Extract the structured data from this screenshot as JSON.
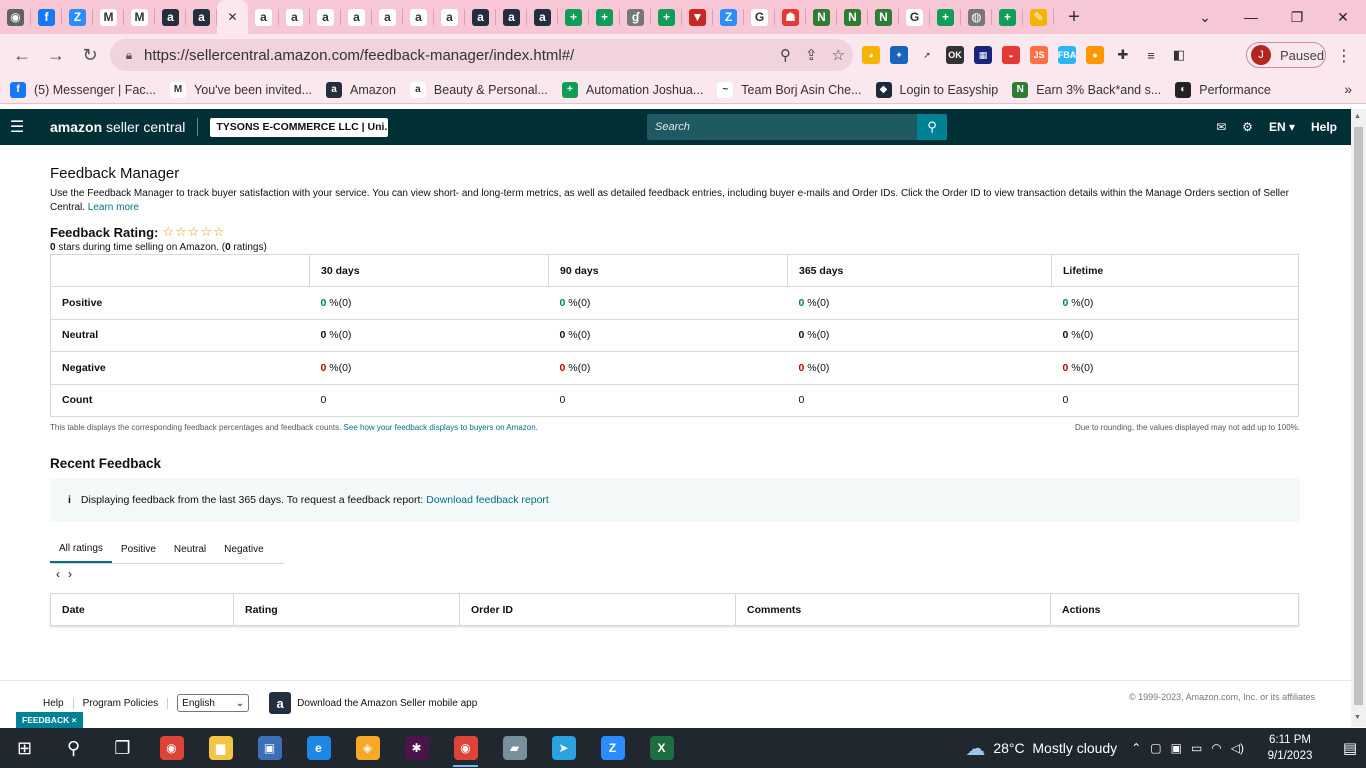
{
  "browser": {
    "tabs": [
      {
        "icon": "chrome-icon",
        "color": "#5f6368",
        "glyph": "◉"
      },
      {
        "icon": "facebook-icon",
        "color": "#1877f2",
        "glyph": "f"
      },
      {
        "icon": "zoom-icon",
        "color": "#2d8cff",
        "glyph": "Z"
      },
      {
        "icon": "gmail-icon",
        "color": "#ffffff",
        "glyph": "M"
      },
      {
        "icon": "gmail-icon",
        "color": "#ffffff",
        "glyph": "M"
      },
      {
        "icon": "amazon-icon",
        "color": "#232f3e",
        "glyph": "a"
      },
      {
        "icon": "amazon-icon",
        "color": "#232f3e",
        "glyph": "a"
      },
      {
        "icon": "amazon-icon",
        "color": "#232f3e",
        "glyph": "a"
      },
      {
        "icon": "amazon-icon",
        "color": "#ffffff",
        "glyph": "a"
      },
      {
        "icon": "amazon-icon",
        "color": "#ffffff",
        "glyph": "a"
      },
      {
        "icon": "amazon-icon",
        "color": "#ffffff",
        "glyph": "a"
      },
      {
        "icon": "amazon-icon",
        "color": "#ffffff",
        "glyph": "a"
      },
      {
        "icon": "amazon-icon",
        "color": "#ffffff",
        "glyph": "a"
      },
      {
        "icon": "amazon-icon",
        "color": "#ffffff",
        "glyph": "a"
      },
      {
        "icon": "amazon-icon",
        "color": "#ffffff",
        "glyph": "a"
      },
      {
        "icon": "amazon-icon",
        "color": "#232f3e",
        "glyph": "a"
      },
      {
        "icon": "amazon-icon",
        "color": "#232f3e",
        "glyph": "a"
      },
      {
        "icon": "amazon-icon",
        "color": "#232f3e",
        "glyph": "a"
      },
      {
        "icon": "sheets-plus-icon",
        "color": "#0f9d58",
        "glyph": "+"
      },
      {
        "icon": "sheets-plus-icon",
        "color": "#0f9d58",
        "glyph": "+"
      },
      {
        "icon": "script-icon",
        "color": "#777777",
        "glyph": "ɠ"
      },
      {
        "icon": "sheets-plus-icon",
        "color": "#0f9d58",
        "glyph": "+"
      },
      {
        "icon": "triangle-icon",
        "color": "#c62828",
        "glyph": "▼"
      },
      {
        "icon": "zoom-icon",
        "color": "#2d8cff",
        "glyph": "Z"
      },
      {
        "icon": "google-icon",
        "color": "#ffffff",
        "glyph": "G"
      },
      {
        "icon": "red-site-icon",
        "color": "#e53935",
        "glyph": "☗"
      },
      {
        "icon": "green-n-icon",
        "color": "#2e7d32",
        "glyph": "N"
      },
      {
        "icon": "green-n-icon",
        "color": "#2e7d32",
        "glyph": "N"
      },
      {
        "icon": "green-n-icon",
        "color": "#2e7d32",
        "glyph": "N"
      },
      {
        "icon": "google-icon",
        "color": "#ffffff",
        "glyph": "G"
      },
      {
        "icon": "sheets-plus-icon",
        "color": "#0f9d58",
        "glyph": "+"
      },
      {
        "icon": "globe-icon",
        "color": "#777777",
        "glyph": "◍"
      },
      {
        "icon": "sheets-plus-icon",
        "color": "#0f9d58",
        "glyph": "+"
      },
      {
        "icon": "pencil-icon",
        "color": "#f4b400",
        "glyph": "✎"
      }
    ],
    "active_tab_index": 7,
    "url": "https://sellercentral.amazon.com/feedback-manager/index.html#/",
    "profile_initial": "J",
    "profile_status": "Paused",
    "bookmarks": [
      {
        "label": "(5) Messenger | Fac...",
        "icon": "facebook-icon",
        "color": "#1877f2",
        "glyph": "f"
      },
      {
        "label": "You've been invited...",
        "icon": "gmail-icon",
        "color": "#ffffff",
        "glyph": "M"
      },
      {
        "label": "Amazon",
        "icon": "amazon-icon",
        "color": "#232f3e",
        "glyph": "a"
      },
      {
        "label": "Beauty & Personal...",
        "icon": "amazon-icon",
        "color": "#ffffff",
        "glyph": "a"
      },
      {
        "label": "Automation Joshua...",
        "icon": "sheets-plus-icon",
        "color": "#0f9d58",
        "glyph": "+"
      },
      {
        "label": "Team Borj Asin Che...",
        "icon": "signature-icon",
        "color": "#ffffff",
        "glyph": "~"
      },
      {
        "label": "Login to Easyship",
        "icon": "easyship-icon",
        "color": "#1b2a3a",
        "glyph": "◆"
      },
      {
        "label": "Earn 3% Back*and s...",
        "icon": "green-n-icon",
        "color": "#2e7d32",
        "glyph": "N"
      },
      {
        "label": "Performance",
        "icon": "performance-icon",
        "color": "#222222",
        "glyph": "◐"
      }
    ]
  },
  "seller_header": {
    "logo_brand": "amazon",
    "logo_suffix": "seller central",
    "account": "TYSONS E-COMMERCE LLC | Uni...",
    "search_placeholder": "Search",
    "language": "EN",
    "help": "Help"
  },
  "page": {
    "title": "Feedback Manager",
    "intro": "Use the Feedback Manager to track buyer satisfaction with your service. You can view short- and long-term metrics, as well as detailed feedback entries, including buyer e-mails and Order IDs. Click the Order ID to view transaction details within the Manage Orders section of Seller Central.",
    "learn_more": "Learn more",
    "rating_label": "Feedback Rating:",
    "rating_stars": "☆☆☆☆☆",
    "rating_stars_value": 0,
    "rating_sub_stars": "0",
    "rating_sub_text1": " stars during time selling on Amazon. (",
    "rating_sub_count": "0",
    "rating_sub_text2": " ratings)"
  },
  "feedback_table": {
    "columns": [
      "30 days",
      "90 days",
      "365 days",
      "Lifetime"
    ],
    "rows": [
      {
        "label": "Positive",
        "values": [
          "0",
          "0",
          "0",
          "0"
        ],
        "suffix": " %(0)",
        "class": "pos"
      },
      {
        "label": "Neutral",
        "values": [
          "0",
          "0",
          "0",
          "0"
        ],
        "suffix": " %(0)",
        "class": "neu"
      },
      {
        "label": "Negative",
        "values": [
          "0",
          "0",
          "0",
          "0"
        ],
        "suffix": " %(0)",
        "class": "neg"
      },
      {
        "label": "Count",
        "values": [
          "0",
          "0",
          "0",
          "0"
        ],
        "suffix": "",
        "class": ""
      }
    ],
    "note_left": "This table displays the corresponding feedback percentages and feedback counts.",
    "note_left_link": "See how your feedback displays to buyers on Amazon.",
    "note_right": "Due to rounding, the values displayed may not add up to 100%."
  },
  "recent": {
    "title": "Recent Feedback",
    "info_icon": "i",
    "info_text": "Displaying feedback from the last 365 days. To request a feedback report:",
    "info_link": "Download feedback report",
    "tabs": [
      "All ratings",
      "Positive",
      "Neutral",
      "Negative"
    ],
    "selected_tab": 0,
    "pager_prev": "‹",
    "pager_next": "›",
    "columns": [
      "Date",
      "Rating",
      "Order ID",
      "Comments",
      "Actions"
    ]
  },
  "footer": {
    "links": [
      "Help",
      "Program Policies"
    ],
    "language_value": "English",
    "app_text": "Download the Amazon Seller mobile app",
    "copyright": "© 1999-2023, Amazon.com, Inc. or its affiliates",
    "feedback_tag": "FEEDBACK ×"
  },
  "taskbar": {
    "apps": [
      {
        "icon": "search-icon",
        "color": "#20272e",
        "glyph": "⚲"
      },
      {
        "icon": "task-view-icon",
        "color": "#20272e",
        "glyph": "❐"
      },
      {
        "icon": "chrome-icon",
        "color": "#db4437",
        "glyph": "◉"
      },
      {
        "icon": "file-explorer-icon",
        "color": "#f4c542",
        "glyph": "▆"
      },
      {
        "icon": "control-panel-icon",
        "color": "#3b6fb6",
        "glyph": "▣"
      },
      {
        "icon": "edge-icon",
        "color": "#1e88e5",
        "glyph": "e"
      },
      {
        "icon": "vpn-icon",
        "color": "#f9a825",
        "glyph": "◈"
      },
      {
        "icon": "slack-icon",
        "color": "#4a154b",
        "glyph": "✱"
      },
      {
        "icon": "chrome-profile-icon",
        "color": "#db4437",
        "glyph": "◉"
      },
      {
        "icon": "notes-icon",
        "color": "#78909c",
        "glyph": "▰"
      },
      {
        "icon": "telegram-icon",
        "color": "#2aa3e0",
        "glyph": "➤"
      },
      {
        "icon": "zoom-icon",
        "color": "#2d8cff",
        "glyph": "Z"
      },
      {
        "icon": "excel-icon",
        "color": "#1d6f42",
        "glyph": "X"
      }
    ],
    "active_app_index": 8,
    "weather_temp": "28°C",
    "weather_text": "Mostly cloudy",
    "time": "6:11 PM",
    "date": "9/1/2023"
  }
}
